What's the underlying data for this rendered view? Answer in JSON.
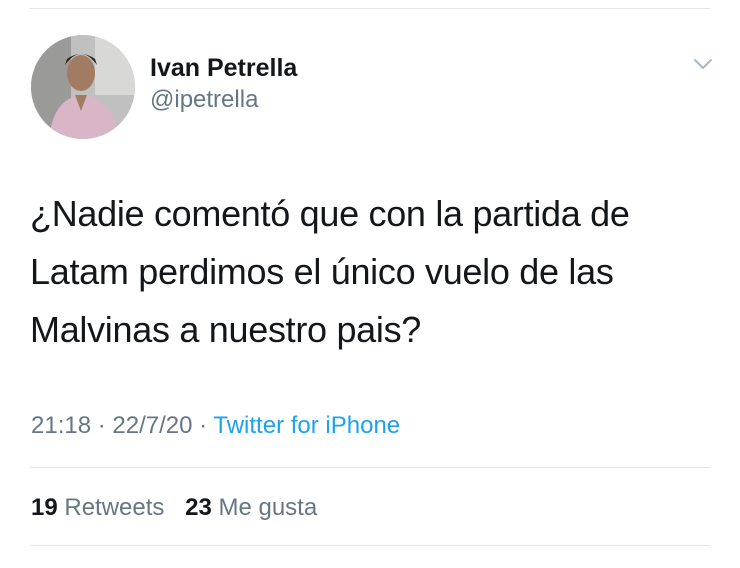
{
  "user": {
    "display_name": "Ivan Petrella",
    "handle": "@ipetrella"
  },
  "tweet": {
    "text_lines": [
      "¿Nadie comentó que con la partida de",
      "Latam perdimos el único vuelo de las",
      "Malvinas a nuestro pais?"
    ]
  },
  "meta": {
    "time": "21:18",
    "separator": "·",
    "date": "22/7/20",
    "source": "Twitter for iPhone"
  },
  "stats": {
    "retweets_count": "19",
    "retweets_label": "Retweets",
    "likes_count": "23",
    "likes_label": "Me gusta"
  },
  "icons": {
    "more": "chevron-down-icon",
    "avatar": "profile-photo"
  },
  "colors": {
    "text_primary": "#14171a",
    "text_secondary": "#657786",
    "link": "#1da1f2",
    "divider": "#e3e6e8"
  }
}
